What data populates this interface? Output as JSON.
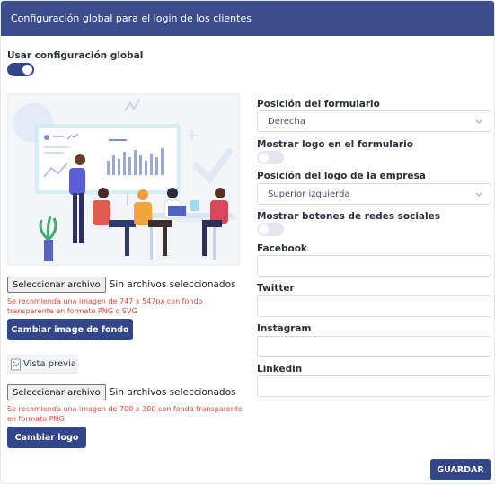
{
  "header": {
    "title": "Configuración global para el login de los clientes"
  },
  "global": {
    "label": "Usar configuración global",
    "enabled": true
  },
  "background": {
    "file_button": "Seleccionar archivo",
    "file_status": "Sin archivos seleccionados",
    "hint": "Se recomienda una imagen de 747 x 547px con fondo transparente en formato PNG o SVG",
    "change_button": "Cambiar image de fondo"
  },
  "logo": {
    "preview_alt": "Vista previa",
    "file_button": "Seleccionar archivo",
    "file_status": "Sin archivos seleccionados",
    "hint": "Se recomienda una imagen de 700 x 300 con fondo transparente en formato PNG",
    "change_button": "Cambiar logo"
  },
  "form": {
    "position_label": "Posición del formulario",
    "position_value": "Derecha",
    "show_logo_label": "Mostrar logo en el formulario",
    "show_logo_enabled": false,
    "logo_position_label": "Posición del logo de la empresa",
    "logo_position_value": "Superior izquierda",
    "social_label": "Mostrar botones de redes sociales",
    "social_enabled": false,
    "facebook_label": "Facebook",
    "facebook_value": "",
    "twitter_label": "Twitter",
    "twitter_value": "",
    "instagram_label": "Instagram",
    "instagram_value": "",
    "linkedin_label": "Linkedin",
    "linkedin_value": ""
  },
  "save_button": "GUARDAR",
  "colors": {
    "header_bg": "#3b4d8a",
    "primary": "#34468a",
    "hint": "#e0453a"
  },
  "icons": [
    "chevron-down-icon",
    "broken-image-icon"
  ]
}
